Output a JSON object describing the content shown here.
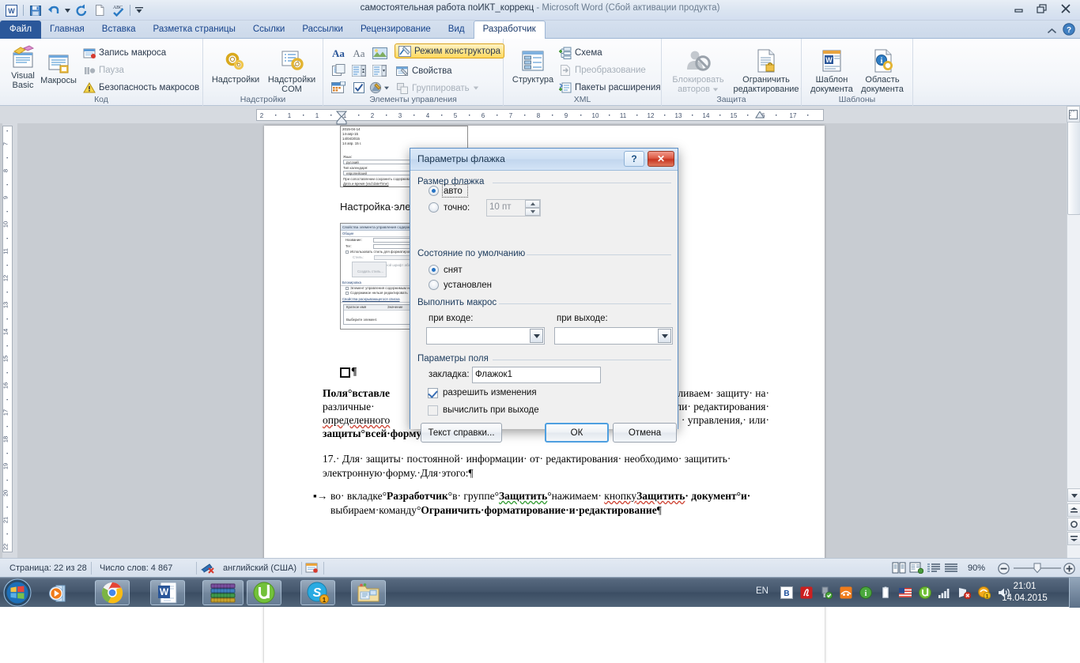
{
  "window": {
    "title": "самостоятельная работа поИКТ_коррекц",
    "title_dim": " -  Microsoft Word (Сбой активации продукта)",
    "minimize": "minimize-button",
    "restore": "restore-button",
    "close": "close-button"
  },
  "qat": {
    "app_icon": "word-logo-icon",
    "save": "save-icon",
    "undo": "undo-icon",
    "undo_more": "undo-dropdown-icon",
    "redo": "redo-icon",
    "new": "new-document-icon",
    "spelling": "spelling-check-icon",
    "customize": "customize-qat-icon"
  },
  "tabs": [
    {
      "label": "Файл",
      "active": false,
      "kind": "file"
    },
    {
      "label": "Главная",
      "active": false,
      "kind": "normal"
    },
    {
      "label": "Вставка",
      "active": false,
      "kind": "normal"
    },
    {
      "label": "Разметка страницы",
      "active": false,
      "kind": "normal"
    },
    {
      "label": "Ссылки",
      "active": false,
      "kind": "normal"
    },
    {
      "label": "Рассылки",
      "active": false,
      "kind": "normal"
    },
    {
      "label": "Рецензирование",
      "active": false,
      "kind": "normal"
    },
    {
      "label": "Вид",
      "active": false,
      "kind": "normal"
    },
    {
      "label": "Разработчик",
      "active": true,
      "kind": "normal"
    }
  ],
  "tab_right": {
    "collapse_ribbon": "chevron-up-icon",
    "help": "help-icon"
  },
  "ribbon": {
    "groups": [
      {
        "name": "Код",
        "big": [
          {
            "label": "Visual\nBasic",
            "label1": "Visual",
            "label2": "Basic",
            "icon": "visual-basic-icon"
          },
          {
            "label": "Макросы",
            "label1": "Макросы",
            "label2": "",
            "icon": "macros-icon"
          }
        ],
        "small": [
          {
            "label": "Запись макроса",
            "icon": "record-macro-icon",
            "disabled": false
          },
          {
            "label": "Пауза",
            "icon": "pause-macro-icon",
            "disabled": true
          },
          {
            "label": "Безопасность макросов",
            "icon": "macro-security-icon",
            "disabled": false
          }
        ]
      },
      {
        "name": "Надстройки",
        "big": [
          {
            "label1": "Надстройки",
            "label2": "",
            "icon": "addins-icon"
          },
          {
            "label1": "Надстройки",
            "label2": "COM",
            "icon": "com-addins-icon"
          }
        ],
        "small": []
      },
      {
        "name": "Элементы управления",
        "grid": [
          "rich-text-content-control-icon",
          "plain-text-content-control-icon",
          "picture-content-control-icon",
          "building-block-gallery-icon",
          "combo-box-content-control-icon",
          "dropdown-list-content-control-icon",
          "date-picker-content-control-icon",
          "check-box-content-control-icon",
          "legacy-tools-icon"
        ],
        "small": [
          {
            "label": "Режим конструктора",
            "icon": "design-mode-icon",
            "disabled": false,
            "highlighted": true
          },
          {
            "label": "Свойства",
            "icon": "properties-icon",
            "disabled": false,
            "highlighted": false
          },
          {
            "label": "Группировать",
            "icon": "group-icon",
            "disabled": true,
            "highlighted": false
          }
        ]
      },
      {
        "name": "XML",
        "big": [
          {
            "label1": "Структура",
            "label2": "",
            "icon": "xml-structure-icon"
          }
        ],
        "small": [
          {
            "label": "Схема",
            "icon": "schema-icon",
            "disabled": false
          },
          {
            "label": "Преобразование",
            "icon": "transformation-icon",
            "disabled": true
          },
          {
            "label": "Пакеты расширения",
            "icon": "expansion-packs-icon",
            "disabled": false
          }
        ]
      },
      {
        "name": "Защита",
        "big": [
          {
            "label1": "Блокировать",
            "label2": "авторов",
            "icon": "block-authors-icon",
            "disabled": true
          },
          {
            "label1": "Ограничить",
            "label2": "редактирование",
            "icon": "restrict-editing-icon",
            "disabled": false
          }
        ],
        "small": []
      },
      {
        "name": "Шаблоны",
        "big": [
          {
            "label1": "Шаблон",
            "label2": "документа",
            "icon": "document-template-icon"
          },
          {
            "label1": "Область",
            "label2": "документа",
            "icon": "document-panel-icon"
          }
        ],
        "small": []
      }
    ]
  },
  "ruler": {
    "tab_selector": "L",
    "horizontal_ticks": [
      "2",
      "1",
      "1",
      "2",
      "3",
      "4",
      "5",
      "6",
      "7",
      "8",
      "9",
      "10",
      "11",
      "12",
      "13",
      "14",
      "15",
      "16",
      "17"
    ],
    "vertical_ticks": [
      "7",
      "8",
      "9",
      "10",
      "11",
      "12",
      "13",
      "14",
      "15",
      "16",
      "17",
      "18",
      "19",
      "20",
      "21",
      "22"
    ]
  },
  "document": {
    "shot1": {
      "rows": [
        "2015-04-14",
        "14-апр-15",
        "14/04/2015",
        "14 апр. 15 г."
      ],
      "fields": [
        {
          "label": "Язык:",
          "value": "русский"
        },
        {
          "label": "Тип календаря:",
          "value": "европейский"
        },
        {
          "label": "При сопоставлении сохранить содержимое",
          "value": "Дата и время (xsd:dateTime)"
        }
      ]
    },
    "heading": "Настройка·элем",
    "shot2": {
      "title": "Свойства элемента управления содержимым",
      "group1": "Общие",
      "f_name": "Название:",
      "f_tag": "Тег:",
      "cb_style": "Использовать стиль для форматирования",
      "f_style_label": "Стиль:",
      "f_style_value": "Основной шрифт абзаца",
      "btn_newstyle": "Создать стиль...",
      "group2": "Блокировка",
      "cb_lock1": "Элемент управления содержимым нельзя удалить",
      "cb_lock2": "Содержимое нельзя редактировать",
      "group3": "Свойства раскрывающегося списка",
      "col1": "Краткое имя",
      "col2": "Значение",
      "item1": "Выберите элемент."
    },
    "checkbox_para": "¶",
    "paragraphs": [
      {
        "id": "p-polya",
        "runs": [
          {
            "t": "Поля",
            "b": true
          },
          {
            "t": "°вставле",
            "b": true
          },
          {
            "t": "…",
            "b": false
          }
        ],
        "text_line1_a": "Поля",
        "text_line1_b": "°вставле",
        "text_line1_c": "авливаем· защиту· на·",
        "text_line2_a": "различные·",
        "text_line2_b": "ли·    редактирования·",
        "text_line3_a": "определенного",
        "text_line3_b": "·  управления,·  или·",
        "text_line4": "защиты°всей·форму·паролем.¶"
      },
      {
        "id": "p-17",
        "line1": "17.·  Для·  защиты·  постоянной·  информации·  от·  редактирования·  необходимо·  защитить·",
        "line2": "электронную·форму.·Для·этого:¶"
      },
      {
        "id": "p-bullet",
        "bullet": "▪→",
        "line1_a": "во·  вкладке°",
        "line1_b": "Разработчик",
        "line1_c": "°в·  группе°",
        "line1_d": "Защитить",
        "line1_e": "°нажимаем·  ",
        "line1_f": "кнопку",
        "line1_g": "Защитить",
        "line1_h": "· документ°и·",
        "line2_a": "выбираем·команду°",
        "line2_b": "Ограничить·форматирование·и·редактирование",
        "line2_c": "¶"
      }
    ]
  },
  "dialog": {
    "title": "Параметры флажка",
    "help_glyph": "?",
    "close_glyph": "✕",
    "section_size": "Размер флажка",
    "radio_auto": "авто",
    "radio_auto_selected": true,
    "radio_exact": "точно:",
    "radio_exact_selected": false,
    "exact_value": "10 пт",
    "section_default": "Состояние по умолчанию",
    "radio_unchecked": "снят",
    "radio_unchecked_selected": true,
    "radio_checked": "установлен",
    "radio_checked_selected": false,
    "section_macro": "Выполнить макрос",
    "label_on_entry": "при входе:",
    "label_on_exit": "при выходе:",
    "combo_entry_value": "",
    "combo_exit_value": "",
    "section_field": "Параметры поля",
    "label_bookmark": "закладка:",
    "bookmark_value": "Флажок1",
    "cb_allow_changes": "разрешить изменения",
    "cb_allow_changes_checked": true,
    "cb_calc_on_exit": "вычислить при выходе",
    "cb_calc_on_exit_checked": false,
    "btn_help_text": "Текст справки...",
    "btn_ok": "ОК",
    "btn_cancel": "Отмена"
  },
  "statusbar": {
    "page": "Страница: 22 из 28",
    "words": "Число слов: 4 867",
    "proof_icon": "proofing-errors-icon",
    "language": "английский (США)",
    "macro_icon": "record-macro-status-icon",
    "views": [
      "print-layout-view-icon",
      "full-screen-reading-view-icon",
      "web-layout-view-icon",
      "outline-view-icon",
      "draft-view-icon"
    ],
    "zoom": "90%",
    "zoom_out": "zoom-out-icon",
    "zoom_in": "zoom-in-icon"
  },
  "taskbar": {
    "start": "windows-start-icon",
    "quicklaunch": [
      "media-player-icon"
    ],
    "apps": [
      "google-chrome-icon",
      "microsoft-word-icon",
      "winrar-icon",
      "utorrent-icon",
      "skype-icon",
      "explorer-folder-icon"
    ],
    "skype_badge": "1",
    "tray": {
      "lang": "EN",
      "icons": [
        "bluetooth-icon",
        "adobe-reader-icon",
        "safely-remove-hardware-icon",
        "asus-utility-icon",
        "info-icon",
        "battery-icon",
        "us-flag-icon",
        "utorrent-tray-icon",
        "signal-strength-icon",
        "network-error-icon",
        "update-badge-icon",
        "volume-icon"
      ],
      "badge": "1"
    },
    "time": "21:01",
    "date": "14.04.2015",
    "show_desktop": "show-desktop-button"
  }
}
